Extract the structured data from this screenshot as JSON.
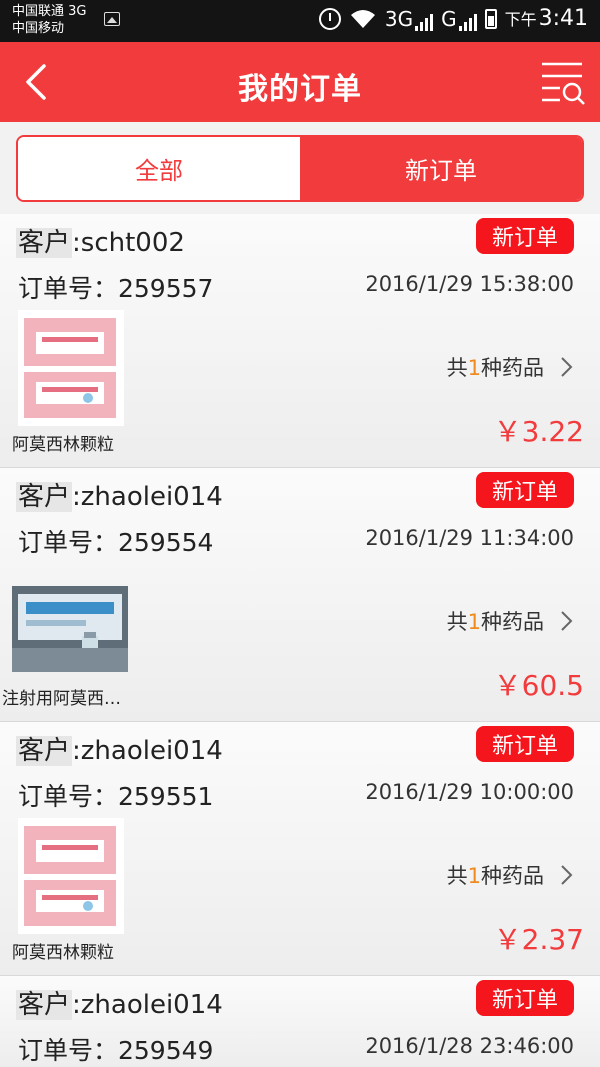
{
  "status_bar": {
    "carrier_1": "中国联通 3G",
    "carrier_2": "中国移动",
    "net_1": "3G",
    "net_2": "G",
    "time_prefix": "下午",
    "time": "3:41"
  },
  "nav": {
    "title": "我的订单",
    "back_icon": "back-arrow-icon",
    "filter_icon": "list-search-icon"
  },
  "tabs": [
    {
      "label": "全部",
      "active": false
    },
    {
      "label": "新订单",
      "active": true
    }
  ],
  "orders": [
    {
      "customer_label": "客户",
      "customer": ":scht002",
      "order_no": "订单号：259557",
      "date": "2016/1/29 15:38:00",
      "badge": "新订单",
      "product_name": "阿莫西林颗粒",
      "count_prefix": "共",
      "count": "1",
      "count_suffix": "种药品",
      "price": "￥3.22",
      "thumb_icon": "medicine-box-pink-image"
    },
    {
      "customer_label": "客户",
      "customer": ":zhaolei014",
      "order_no": "订单号：259554",
      "date": "2016/1/29 11:34:00",
      "badge": "新订单",
      "product_name": "注射用阿莫西…",
      "count_prefix": "共",
      "count": "1",
      "count_suffix": "种药品",
      "price": "￥60.5",
      "thumb_icon": "injection-vial-box-image"
    },
    {
      "customer_label": "客户",
      "customer": ":zhaolei014",
      "order_no": "订单号：259551",
      "date": "2016/1/29 10:00:00",
      "badge": "新订单",
      "product_name": "阿莫西林颗粒",
      "count_prefix": "共",
      "count": "1",
      "count_suffix": "种药品",
      "price": "￥2.37",
      "thumb_icon": "medicine-box-pink-image"
    },
    {
      "customer_label": "客户",
      "customer": ":zhaolei014",
      "order_no": "订单号：259549",
      "date": "2016/1/28 23:46:00",
      "badge": "新订单",
      "product_name": "",
      "count_prefix": "",
      "count": "",
      "count_suffix": "",
      "price": "",
      "thumb_icon": ""
    }
  ],
  "colors": {
    "accent": "#f23b3d",
    "badge": "#f5151c",
    "count_highlight": "#f08a1e"
  }
}
